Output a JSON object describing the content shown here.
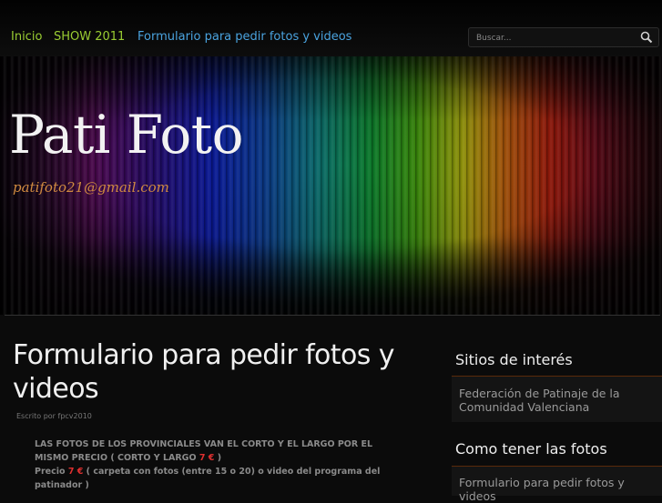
{
  "nav": {
    "items": [
      {
        "label": "Inicio"
      },
      {
        "label": "SHOW 2011"
      },
      {
        "label": "Formulario para pedir fotos y videos"
      }
    ]
  },
  "search": {
    "placeholder": "Buscar..."
  },
  "header": {
    "title": "Pati Foto",
    "email": "patifoto21@gmail.com"
  },
  "article": {
    "title": "Formulario para pedir fotos y videos",
    "byline": "Escrito por fpcv2010",
    "line1": "LAS FOTOS DE LOS PROVINCIALES VAN EL CORTO Y EL LARGO POR EL MISMO PRECIO ( CORTO Y LARGO",
    "price1": "7 €",
    "line1_end": ")",
    "line2_prefix": "Precio",
    "price2": "7 €",
    "line2": "( carpeta con fotos (entre 15 o 20) o video del programa del patinador )"
  },
  "sidebar": {
    "sections": [
      {
        "title": "Sitios de interés",
        "link": "Federación de Patinaje de la Comunidad Valenciana"
      },
      {
        "title": "Como tener las fotos",
        "link": "Formulario para pedir fotos y videos"
      }
    ]
  },
  "colors": {
    "nav_primary": "#9acd32",
    "nav_active": "#4aa3df",
    "email": "#d08a40",
    "price": "#e03030",
    "sidebar_rule": "#5a2a0a"
  }
}
